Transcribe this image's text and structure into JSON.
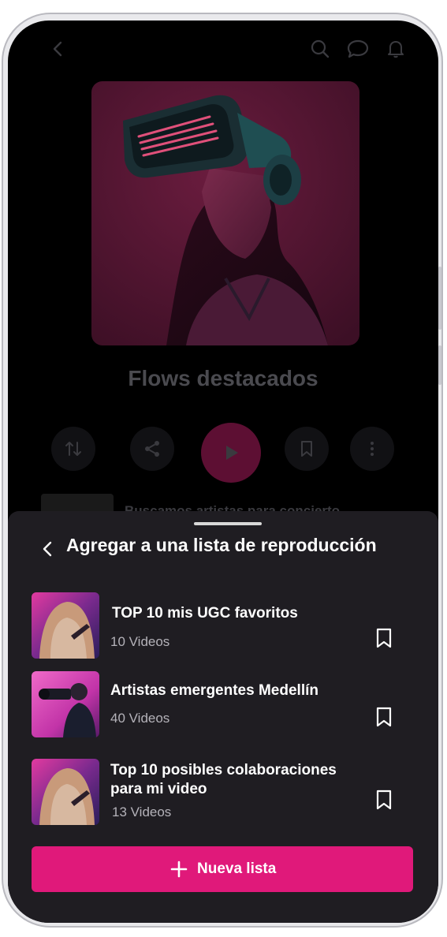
{
  "header": {
    "icons": [
      "chevron-left-icon",
      "search-icon",
      "chat-icon",
      "bell-icon"
    ]
  },
  "playlist": {
    "title": "Flows destacados",
    "peek_item_text": "Buscamos artistas para concierto"
  },
  "sheet": {
    "title": "Agregar a una lista de reproducción",
    "lists": [
      {
        "title": "TOP 10 mis UGC favoritos",
        "count": "10 Videos"
      },
      {
        "title": "Artistas emergentes Medellín",
        "count": "40 Videos"
      },
      {
        "title": "Top 10 posibles colaboraciones para mi video",
        "count": "13 Videos"
      }
    ],
    "new_list_label": "Nueva lista"
  },
  "colors": {
    "accent": "#e0197a",
    "sheet_bg": "#1f1d22",
    "screen_bg": "#000000"
  }
}
